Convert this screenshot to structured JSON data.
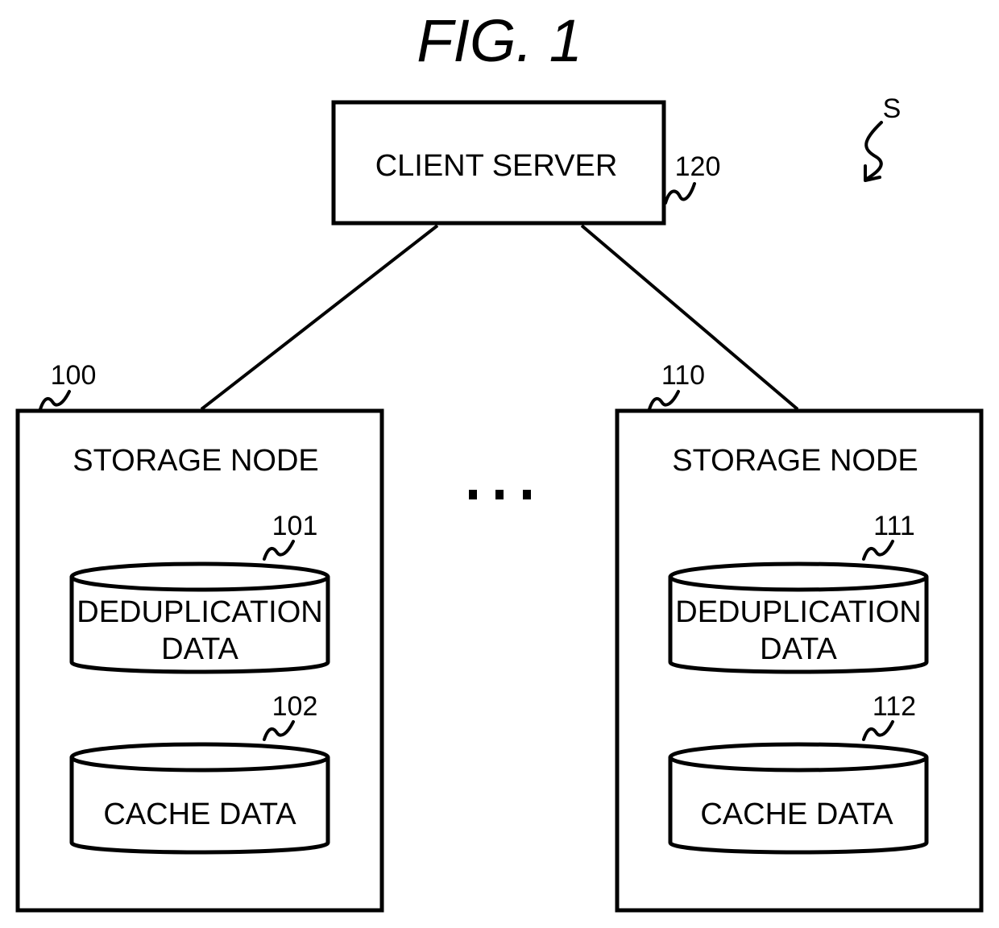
{
  "figure": {
    "title": "FIG. 1",
    "system_ref": "S"
  },
  "client_server": {
    "label": "CLIENT SERVER",
    "ref": "120"
  },
  "ellipsis": "...",
  "storage_nodes": [
    {
      "label": "STORAGE NODE",
      "ref": "100",
      "stores": [
        {
          "label_lines": [
            "DEDUPLICATION",
            "DATA"
          ],
          "ref": "101"
        },
        {
          "label_lines": [
            "CACHE DATA"
          ],
          "ref": "102"
        }
      ]
    },
    {
      "label": "STORAGE NODE",
      "ref": "110",
      "stores": [
        {
          "label_lines": [
            "DEDUPLICATION",
            "DATA"
          ],
          "ref": "111"
        },
        {
          "label_lines": [
            "CACHE DATA"
          ],
          "ref": "112"
        }
      ]
    }
  ]
}
